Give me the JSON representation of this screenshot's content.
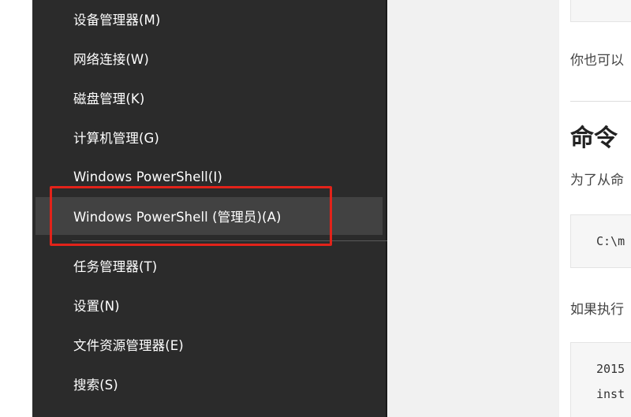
{
  "context_menu": {
    "items": [
      {
        "label": "设备管理器(M)"
      },
      {
        "label": "网络连接(W)"
      },
      {
        "label": "磁盘管理(K)"
      },
      {
        "label": "计算机管理(G)"
      },
      {
        "label": "Windows PowerShell(I)"
      },
      {
        "label": "Windows PowerShell (管理员)(A)",
        "hovered": true,
        "highlighted": true
      },
      {
        "label": "任务管理器(T)"
      },
      {
        "label": "设置(N)"
      },
      {
        "label": "文件资源管理器(E)"
      },
      {
        "label": "搜索(S)"
      }
    ],
    "highlight_color": "#e2231a",
    "background_color": "#2b2b2b"
  },
  "document": {
    "paragraph_1": "你也可以",
    "heading": "命令",
    "paragraph_2": "为了从命",
    "code_block_1": "C:\\m",
    "paragraph_3": "如果执行",
    "code_block_2": {
      "line_1": "2015",
      "line_2": "inst"
    }
  }
}
